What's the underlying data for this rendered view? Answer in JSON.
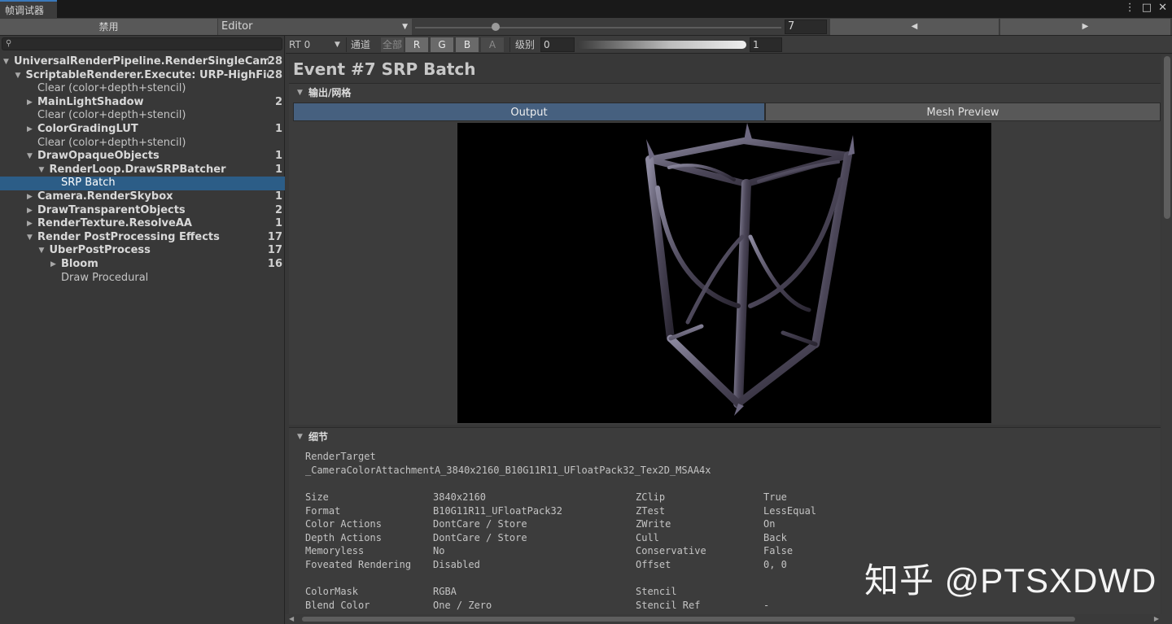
{
  "window": {
    "tab_title": "帧调试器",
    "menu_icon": "⋮",
    "maximize_icon": "□",
    "close_icon": "✕"
  },
  "toolbar": {
    "disable_label": "禁用",
    "target_value": "Editor",
    "frame_value": "7",
    "frame_slider_fraction": 0.22,
    "prev_label": "◀",
    "next_label": "▶"
  },
  "search": {
    "icon": "🔍",
    "placeholder": ""
  },
  "tree": [
    {
      "label": "UniversalRenderPipeline.RenderSingleCameraInte",
      "count": "28",
      "depth": 0,
      "expand": "open",
      "bold": true
    },
    {
      "label": "ScriptableRenderer.Execute: URP-HighFidelity-F",
      "count": "28",
      "depth": 1,
      "expand": "open",
      "bold": true
    },
    {
      "label": "Clear (color+depth+stencil)",
      "count": "",
      "depth": 2,
      "expand": "none",
      "bold": false
    },
    {
      "label": "MainLightShadow",
      "count": "2",
      "depth": 2,
      "expand": "closed",
      "bold": true
    },
    {
      "label": "Clear (color+depth+stencil)",
      "count": "",
      "depth": 2,
      "expand": "none",
      "bold": false
    },
    {
      "label": "ColorGradingLUT",
      "count": "1",
      "depth": 2,
      "expand": "closed",
      "bold": true
    },
    {
      "label": "Clear (color+depth+stencil)",
      "count": "",
      "depth": 2,
      "expand": "none",
      "bold": false
    },
    {
      "label": "DrawOpaqueObjects",
      "count": "1",
      "depth": 2,
      "expand": "open",
      "bold": true
    },
    {
      "label": "RenderLoop.DrawSRPBatcher",
      "count": "1",
      "depth": 3,
      "expand": "open",
      "bold": true
    },
    {
      "label": "SRP Batch",
      "count": "",
      "depth": 4,
      "expand": "none",
      "bold": false,
      "selected": true
    },
    {
      "label": "Camera.RenderSkybox",
      "count": "1",
      "depth": 2,
      "expand": "closed",
      "bold": true
    },
    {
      "label": "DrawTransparentObjects",
      "count": "2",
      "depth": 2,
      "expand": "closed",
      "bold": true
    },
    {
      "label": "RenderTexture.ResolveAA",
      "count": "1",
      "depth": 2,
      "expand": "closed",
      "bold": true
    },
    {
      "label": "Render PostProcessing Effects",
      "count": "17",
      "depth": 2,
      "expand": "open",
      "bold": true
    },
    {
      "label": "UberPostProcess",
      "count": "17",
      "depth": 3,
      "expand": "open",
      "bold": true
    },
    {
      "label": "Bloom",
      "count": "16",
      "depth": 4,
      "expand": "closed",
      "bold": true
    },
    {
      "label": "Draw Procedural",
      "count": "",
      "depth": 4,
      "expand": "none",
      "bold": false
    }
  ],
  "right_toolbar": {
    "rt_value": "RT 0",
    "channel_label": "通道",
    "all_label": "全部",
    "channels": [
      "R",
      "G",
      "B",
      "A"
    ],
    "level_label": "级别",
    "level_min": "0",
    "level_max": "1"
  },
  "event": {
    "title": "Event #7 SRP Batch",
    "output_section": "输出/网格",
    "tab_output": "Output",
    "tab_mesh": "Mesh Preview",
    "details_section": "细节",
    "render_target_label": "RenderTarget",
    "render_target_value": "_CameraColorAttachmentA_3840x2160_B10G11R11_UFloatPack32_Tex2D_MSAA4x",
    "left_props": [
      {
        "k": "Size",
        "v": "3840x2160"
      },
      {
        "k": "Format",
        "v": "B10G11R11_UFloatPack32"
      },
      {
        "k": "Color Actions",
        "v": "DontCare / Store"
      },
      {
        "k": "Depth Actions",
        "v": "DontCare / Store"
      },
      {
        "k": "Memoryless",
        "v": "No"
      },
      {
        "k": "Foveated Rendering",
        "v": "Disabled"
      }
    ],
    "right_props": [
      {
        "k": "ZClip",
        "v": "True"
      },
      {
        "k": "ZTest",
        "v": "LessEqual"
      },
      {
        "k": "ZWrite",
        "v": "On"
      },
      {
        "k": "Cull",
        "v": "Back"
      },
      {
        "k": "Conservative",
        "v": "False"
      },
      {
        "k": "Offset",
        "v": "0, 0"
      }
    ],
    "left_props2": [
      {
        "k": "ColorMask",
        "v": "RGBA"
      },
      {
        "k": "Blend Color",
        "v": "One / Zero"
      }
    ],
    "right_props2": [
      {
        "k": "Stencil",
        "v": ""
      },
      {
        "k": "Stencil Ref",
        "v": "-"
      }
    ]
  },
  "watermark": "知乎 @PTSXDWD"
}
